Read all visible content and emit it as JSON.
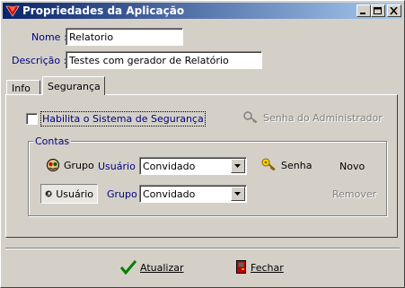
{
  "window": {
    "title": "Propriedades da Aplicação"
  },
  "form": {
    "name_label": "Nome :",
    "name_value": "Relatorio",
    "desc_label": "Descrição :",
    "desc_value": "Testes com gerador de Relatório"
  },
  "tabs": [
    {
      "label": "Info",
      "active": false
    },
    {
      "label": "Segurança",
      "active": true
    }
  ],
  "security": {
    "enable_label": "Habilita o Sistema de Segurança",
    "enable_checked": false,
    "admin_password_label": "Senha do Administrador",
    "contas_title": "Contas",
    "grupo_button": "Grupo",
    "usuario_button": "Usuário",
    "usuario_label": "Usuário :",
    "usuario_value": "Convidado",
    "grupo_label": "Grupo :",
    "grupo_value": "Convidado",
    "senha_label": "Senha",
    "novo_label": "Novo",
    "remover_label": "Remover"
  },
  "footer": {
    "atualizar_label": "Atualizar",
    "fechar_label": "Fechar"
  },
  "colors": {
    "titlebar_start": "#0a246a",
    "titlebar_end": "#a6caf0",
    "label_blue": "#000080"
  }
}
